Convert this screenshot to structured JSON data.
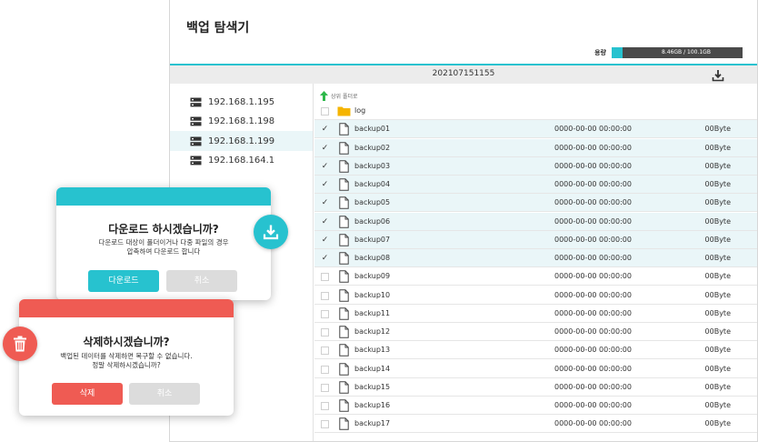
{
  "explorer": {
    "title": "백업 탐색기",
    "capacity_label": "용량",
    "capacity_text": "8.46GB / 100.1GB",
    "capacity_fraction": 0.0845,
    "current_folder": "202107151155",
    "up_folder_label": "상위 폴더로",
    "servers": [
      {
        "label": "192.168.1.195",
        "selected": false
      },
      {
        "label": "192.168.1.198",
        "selected": false
      },
      {
        "label": "192.168.1.199",
        "selected": true
      },
      {
        "label": "192.168.164.1",
        "selected": false
      }
    ],
    "folders": [
      {
        "name": "log"
      }
    ],
    "files": [
      {
        "name": "backup01",
        "date": "0000-00-00  00:00:00",
        "size": "00Byte",
        "checked": true
      },
      {
        "name": "backup02",
        "date": "0000-00-00  00:00:00",
        "size": "00Byte",
        "checked": true
      },
      {
        "name": "backup03",
        "date": "0000-00-00  00:00:00",
        "size": "00Byte",
        "checked": true
      },
      {
        "name": "backup04",
        "date": "0000-00-00  00:00:00",
        "size": "00Byte",
        "checked": true
      },
      {
        "name": "backup05",
        "date": "0000-00-00  00:00:00",
        "size": "00Byte",
        "checked": true
      },
      {
        "name": "backup06",
        "date": "0000-00-00  00:00:00",
        "size": "00Byte",
        "checked": true
      },
      {
        "name": "backup07",
        "date": "0000-00-00  00:00:00",
        "size": "00Byte",
        "checked": true
      },
      {
        "name": "backup08",
        "date": "0000-00-00  00:00:00",
        "size": "00Byte",
        "checked": true
      },
      {
        "name": "backup09",
        "date": "0000-00-00  00:00:00",
        "size": "00Byte",
        "checked": false
      },
      {
        "name": "backup10",
        "date": "0000-00-00  00:00:00",
        "size": "00Byte",
        "checked": false
      },
      {
        "name": "backup11",
        "date": "0000-00-00  00:00:00",
        "size": "00Byte",
        "checked": false
      },
      {
        "name": "backup12",
        "date": "0000-00-00  00:00:00",
        "size": "00Byte",
        "checked": false
      },
      {
        "name": "backup13",
        "date": "0000-00-00  00:00:00",
        "size": "00Byte",
        "checked": false
      },
      {
        "name": "backup14",
        "date": "0000-00-00  00:00:00",
        "size": "00Byte",
        "checked": false
      },
      {
        "name": "backup15",
        "date": "0000-00-00  00:00:00",
        "size": "00Byte",
        "checked": false
      },
      {
        "name": "backup16",
        "date": "0000-00-00  00:00:00",
        "size": "00Byte",
        "checked": false
      },
      {
        "name": "backup17",
        "date": "0000-00-00  00:00:00",
        "size": "00Byte",
        "checked": false
      }
    ]
  },
  "download_dialog": {
    "title": "다운로드 하시겠습니까?",
    "message_line1": "다운로드 대상이 폴더이거나 다중 파일의 경우",
    "message_line2": "압축하여 다운로드 합니다",
    "confirm_label": "다운로드",
    "cancel_label": "취소",
    "accent_color": "#27c2cf",
    "icon": "download-icon"
  },
  "delete_dialog": {
    "title": "삭제하시겠습니까?",
    "message_line1": "백업된 데이터를 삭제하면 복구할 수 없습니다.",
    "message_line2": "정말 삭제하시겠습니까?",
    "confirm_label": "삭제",
    "cancel_label": "취소",
    "accent_color": "#ef5b53",
    "icon": "trash-icon"
  },
  "colors": {
    "accent": "#27c2cf",
    "danger": "#ef5b53",
    "selected_row": "#eaf6f8"
  }
}
